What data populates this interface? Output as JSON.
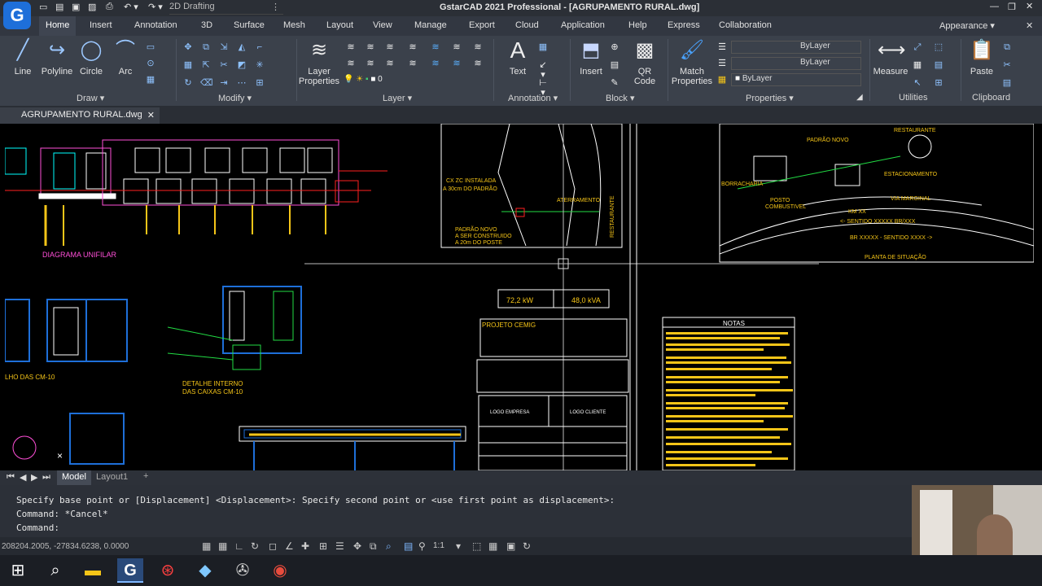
{
  "titlebar": {
    "title": "GstarCAD 2021 Professional - [AGRUPAMENTO RURAL.dwg]",
    "workspace": "2D Drafting"
  },
  "ribbon_tabs": [
    "Home",
    "Insert",
    "Annotation",
    "3D",
    "Surface",
    "Mesh",
    "Layout",
    "View",
    "Manage",
    "Export",
    "Cloud",
    "Application",
    "Help",
    "Express",
    "Collaboration"
  ],
  "appearance": "Appearance",
  "draw": {
    "panel": "Draw",
    "line": "Line",
    "polyline": "Polyline",
    "circle": "Circle",
    "arc": "Arc"
  },
  "modify": {
    "panel": "Modify"
  },
  "layer": {
    "panel": "Layer",
    "layer_properties": "Layer Properties",
    "current_layer": "0"
  },
  "annotation": {
    "panel": "Annotation",
    "text": "Text"
  },
  "block": {
    "panel": "Block",
    "insert": "Insert",
    "qrcode": "QR Code"
  },
  "properties": {
    "panel": "Properties",
    "match": "Match Properties",
    "color": "ByLayer",
    "linetype": "ByLayer",
    "lineweight": "ByLayer"
  },
  "utilities": {
    "panel": "Utilities",
    "measure": "Measure"
  },
  "clipboard": {
    "panel": "Clipboard",
    "paste": "Paste"
  },
  "doc_tab": "AGRUPAMENTO RURAL.dwg",
  "layout_tabs": {
    "model": "Model",
    "layout1": "Layout1",
    "add": "+"
  },
  "drawing": {
    "diagram_title": "DIAGRAMA UNIFILAR",
    "detail_title": "DETALHE INTERNO",
    "detail_sub": "DAS CAIXAS CM-10",
    "left_label": "LHO DAS CM-10",
    "cx_label": "CX ZC INSTALADA",
    "cx_sub": "A 30cm DO PADRÃO",
    "padrao": "PADRÃO NOVO",
    "padrao2": "A SER CONSTRUIDO",
    "padrao3": "A 20m DO POSTE",
    "aterramento": "ATERRAMENTO",
    "restaurante": "RESTAURANTE",
    "estacionamento": "ESTACIONAMENTO",
    "posto": "POSTO",
    "combustivel": "COMBUSTIVEL",
    "borracharia": "BORRACHARIA",
    "via_marginal": "VIA MARGINAL",
    "km": "KM XX",
    "sentido1": "<- SENTIDO XXXXX BR/XXX",
    "sentido2": "BR XXXXX - SENTIDO XXXX ->",
    "situacao": "PLANTA DE SITUAÇÃO",
    "carga": "72,2 kW",
    "demanda": "48,0 kVA",
    "projeto": "PROJETO CEMIG",
    "notas": "NOTAS",
    "logo_empresa": "LOGO EMPRESA",
    "logo_cliente": "LOGO CLIENTE"
  },
  "command": {
    "line1": "Specify base point or [Displacement] <Displacement>: Specify second point or <use first point as displacement>:",
    "line2": "Command: *Cancel*",
    "prompt": "Command:"
  },
  "status": {
    "coords": "208204.2005, -27834.6238, 0.0000",
    "scale": "1:1"
  },
  "colors": {
    "accent": "#1e6fd9",
    "yellow": "#f5c518",
    "cyan": "#00ffff",
    "magenta": "#ff4fd8",
    "red": "#ff2020",
    "green": "#22dd44"
  }
}
